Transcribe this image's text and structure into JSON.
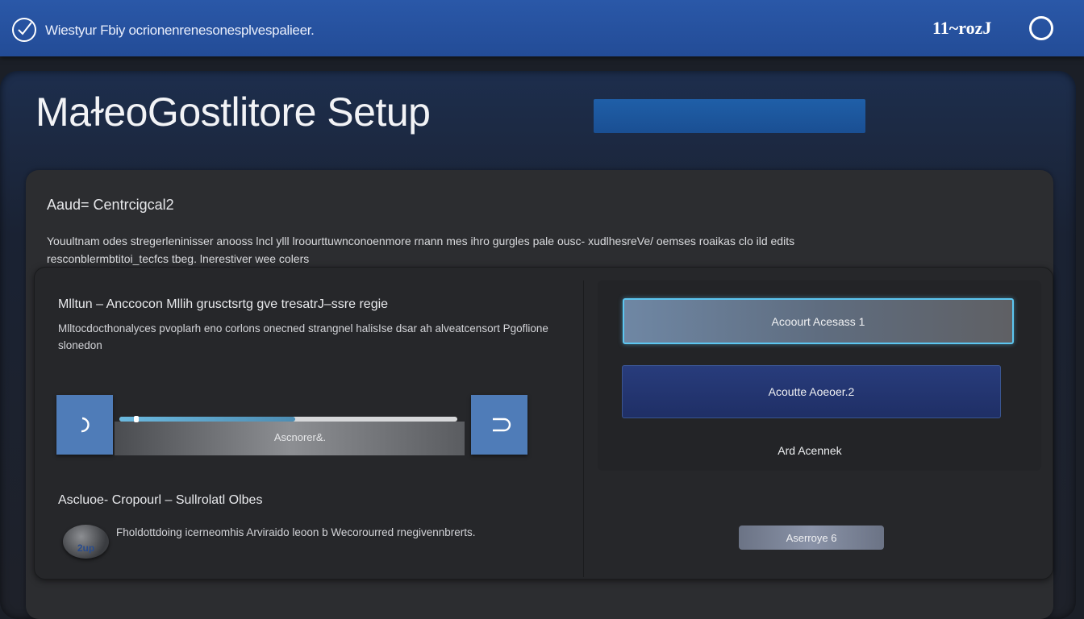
{
  "topbar": {
    "title": "Wiestyur Fbiy ocrionenrenesonesplvespalieer.",
    "count": "11~rozJ"
  },
  "page": {
    "heading": "MaɫeoGostlitore Setup"
  },
  "card": {
    "title": "Aaud= Centrcigcal2",
    "description": "Youultnam odes stregerleninisser anooss lncl ylll lroourttuwnconoenmore rnann mes ihro gurgles pale ousc- xudlhesreVe/ oemses roaikas clo ild edits resconblermbtitoi_tecfcs tbeg. lnerestiver wee colers"
  },
  "left_section": {
    "title": "Mlltun – Anccocon Mllih grusctsrtg gve tresatrJ–ssre regie",
    "description": "Mlltocdocthonalyces pvoplarh eno corlons onecned strangnel halisIse dsar ah alveatcensort Pgoflione slonedon",
    "slider_label": "Ascnorer&.",
    "slider_value": 0.52,
    "minus_glyph": "⊃",
    "plus_glyph": "⊃"
  },
  "bottom_section": {
    "title": "Ascluoe- Cropourl – Sullrolatl Olbes",
    "description": "Fholdottdoing icerneomhis Arviraido leoon b Wecorourred rnegivennbrerts.",
    "badge_text": "2up"
  },
  "right_panel": {
    "account1": "Acoourt Acesass 1",
    "account2": "Acoutte Aoeoer.2",
    "add_account": "Ard Acennek",
    "account6": "Aserroye 6"
  },
  "colors": {
    "topbar": "#2a58a8",
    "accent": "#5cc6f0",
    "step_button": "#4f7cb8",
    "account2": "#283c7c"
  }
}
